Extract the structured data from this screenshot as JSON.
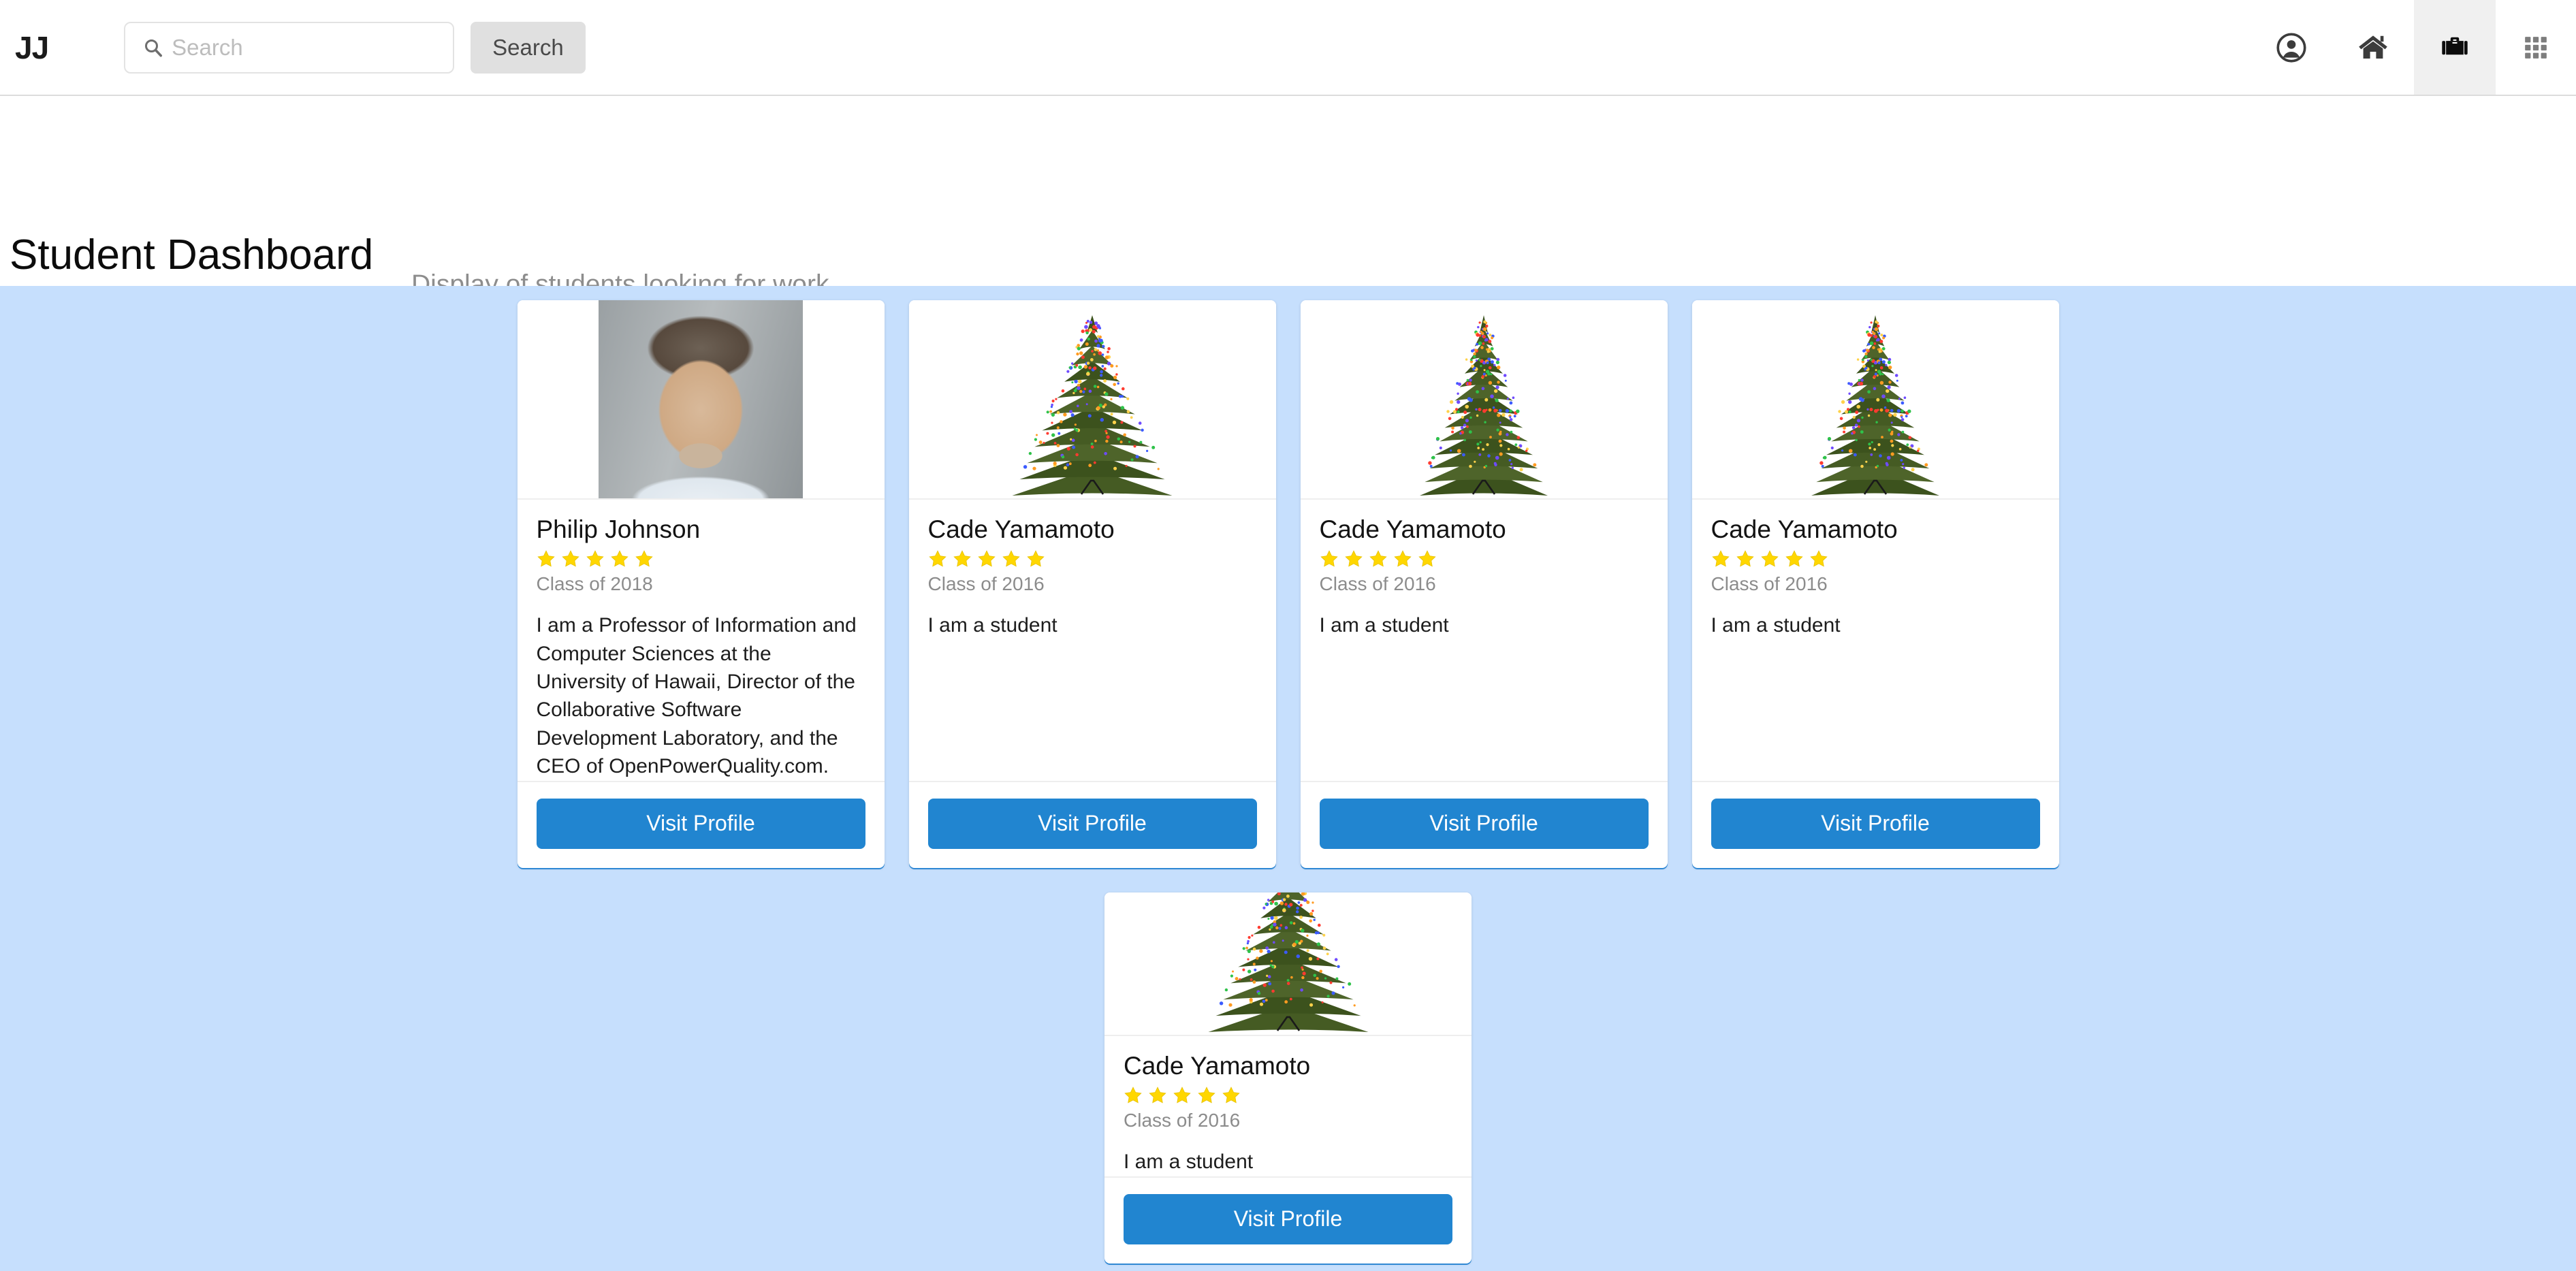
{
  "header": {
    "brand": "JJ",
    "search": {
      "placeholder": "Search",
      "value": "",
      "icon": "search-icon",
      "button_label": "Search"
    },
    "nav_icons": [
      {
        "name": "account-circle-icon",
        "label": "Profile",
        "active": false
      },
      {
        "name": "home-icon",
        "label": "Home",
        "active": false
      },
      {
        "name": "briefcase-icon",
        "label": "Jobs",
        "active": true
      },
      {
        "name": "apps-grid-icon",
        "label": "Apps",
        "active": false
      }
    ]
  },
  "page": {
    "title": "Student Dashboard",
    "subtitle": "Display of students looking for work"
  },
  "colors": {
    "board_background": "#c6dffd",
    "primary_button": "#2185d0",
    "star": "#ffd700",
    "muted_text": "#8c8c8c",
    "active_nav": "#f0f0f0"
  },
  "cards": [
    {
      "name": "Philip Johnson",
      "rating": 5,
      "meta": "Class of 2018",
      "description": "I am a Professor of Information and Computer Sciences at the University of Hawaii, Director of the Collaborative Software Development Laboratory, and the CEO of OpenPowerQuality.com.",
      "image": "portrait-photo",
      "button_label": "Visit Profile"
    },
    {
      "name": "Cade Yamamoto",
      "rating": 5,
      "meta": "Class of 2016",
      "description": "I am a student",
      "image": "christmas-tree-wide",
      "button_label": "Visit Profile"
    },
    {
      "name": "Cade Yamamoto",
      "rating": 5,
      "meta": "Class of 2016",
      "description": "I am a student",
      "image": "christmas-tree-narrow",
      "button_label": "Visit Profile"
    },
    {
      "name": "Cade Yamamoto",
      "rating": 5,
      "meta": "Class of 2016",
      "description": "I am a student",
      "image": "christmas-tree-narrow",
      "button_label": "Visit Profile"
    },
    {
      "name": "Cade Yamamoto",
      "rating": 5,
      "meta": "Class of 2016",
      "description": "I am a student",
      "image": "christmas-tree-wide",
      "button_label": "Visit Profile"
    }
  ]
}
